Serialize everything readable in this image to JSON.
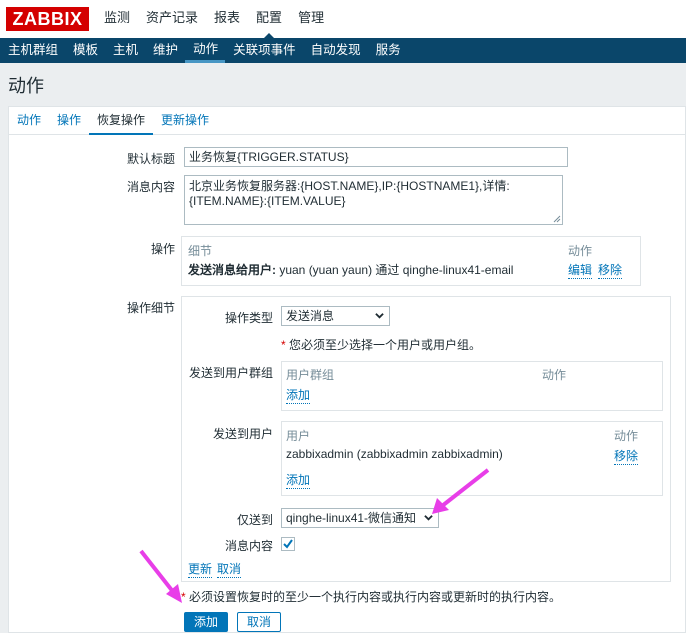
{
  "logo": "ZABBIX",
  "top_menu": [
    "监测",
    "资产记录",
    "报表",
    "配置",
    "管理"
  ],
  "sub_menu": [
    "主机群组",
    "模板",
    "主机",
    "维护",
    "动作",
    "关联项事件",
    "自动发现",
    "服务"
  ],
  "page_title": "动作",
  "tabs": [
    "动作",
    "操作",
    "恢复操作",
    "更新操作"
  ],
  "form": {
    "default_subject_label": "默认标题",
    "default_subject_value": "业务恢复{TRIGGER.STATUS}",
    "message_label": "消息内容",
    "message_value": "北京业务恢复服务器:{HOST.NAME},IP:{HOSTNAME1},详情:\n{ITEM.NAME}:{ITEM.VALUE}",
    "operations_label": "操作",
    "operations_table": {
      "col_details": "细节",
      "col_action": "动作",
      "row_prefix": "发送消息给用户:",
      "row_text": " yuan (yuan yaun) 通过 qinghe-linux41-email",
      "edit": "编辑",
      "remove": "移除"
    },
    "op_details_label": "操作细节",
    "op_type_label": "操作类型",
    "op_type_value": "发送消息",
    "op_required_note": "您必须至少选择一个用户或用户组。",
    "send_to_groups_label": "发送到用户群组",
    "groups_table": {
      "col_group": "用户群组",
      "col_action": "动作",
      "add": "添加"
    },
    "send_to_users_label": "发送到用户",
    "users_table": {
      "col_user": "用户",
      "col_action": "动作",
      "row_user": "zabbixadmin (zabbixadmin zabbixadmin)",
      "remove": "移除",
      "add": "添加"
    },
    "only_send_label": "仅送到",
    "only_send_value": "qinghe-linux41-微信通知",
    "message_content_label": "消息内容",
    "update_link": "更新",
    "cancel_link": "取消",
    "bottom_required_note": "必须设置恢复时的至少一个执行内容或执行内容或更新时的执行内容。",
    "add_button": "添加",
    "cancel_button": "取消"
  },
  "colors": {
    "brand": "#d40000",
    "nav": "#0a466a",
    "link": "#0275b8",
    "annotation_arrow": "#e83ee8"
  }
}
